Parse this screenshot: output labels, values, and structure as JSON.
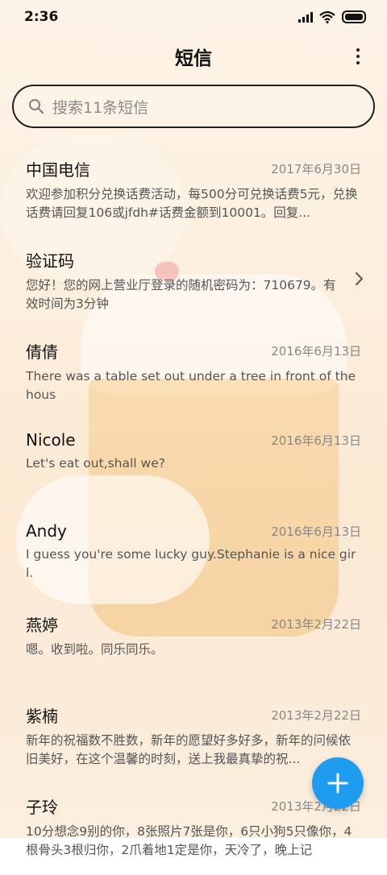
{
  "status_bar": {
    "time": "2:36"
  },
  "header": {
    "title": "短信"
  },
  "search": {
    "placeholder": "搜索11条短信"
  },
  "messages": [
    {
      "name": "中国电信",
      "date": "2017年6月30日",
      "preview": "欢迎参加积分兑换话费活动，每500分可兑换话费5元，兑换话费请回复106或jfdh#话费金额到10001。回复..."
    },
    {
      "name": "验证码",
      "date": "",
      "preview": "您好！您的网上营业厅登录的随机密码为：710679。有效时间为3分钟"
    },
    {
      "name": "倩倩",
      "date": "2016年6月13日",
      "preview": "There was a table set out under a tree in front of the hous"
    },
    {
      "name": "Nicole",
      "date": "2016年6月13日",
      "preview": "Let's eat out,shall we?"
    },
    {
      "name": "Andy",
      "date": "2016年6月13日",
      "preview": "I guess you're some lucky guy.Stephanie is a nice girl."
    },
    {
      "name": "燕婷",
      "date": "2013年2月22日",
      "preview": "嗯。收到啦。同乐同乐。"
    },
    {
      "name": "紫楠",
      "date": "2013年2月22日",
      "preview": "新年的祝福数不胜数，新年的愿望好多好多，新年的问候依旧美好，在这个温馨的时刻，送上我最真挚的祝..."
    },
    {
      "name": "子玲",
      "date": "2013年2月22日",
      "preview": "10分想念9别的你，8张照片7张是你，6只小狗5只像你，4根骨头3根归你，2爪着地1定是你，天冷了，晚上记"
    }
  ],
  "colors": {
    "accent": "#1e9cf0",
    "background": "#fcefdf"
  },
  "icons": [
    "search-icon",
    "more-vertical-icon",
    "chevron-right-icon",
    "plus-icon",
    "signal-icon",
    "wifi-icon",
    "battery-icon"
  ]
}
